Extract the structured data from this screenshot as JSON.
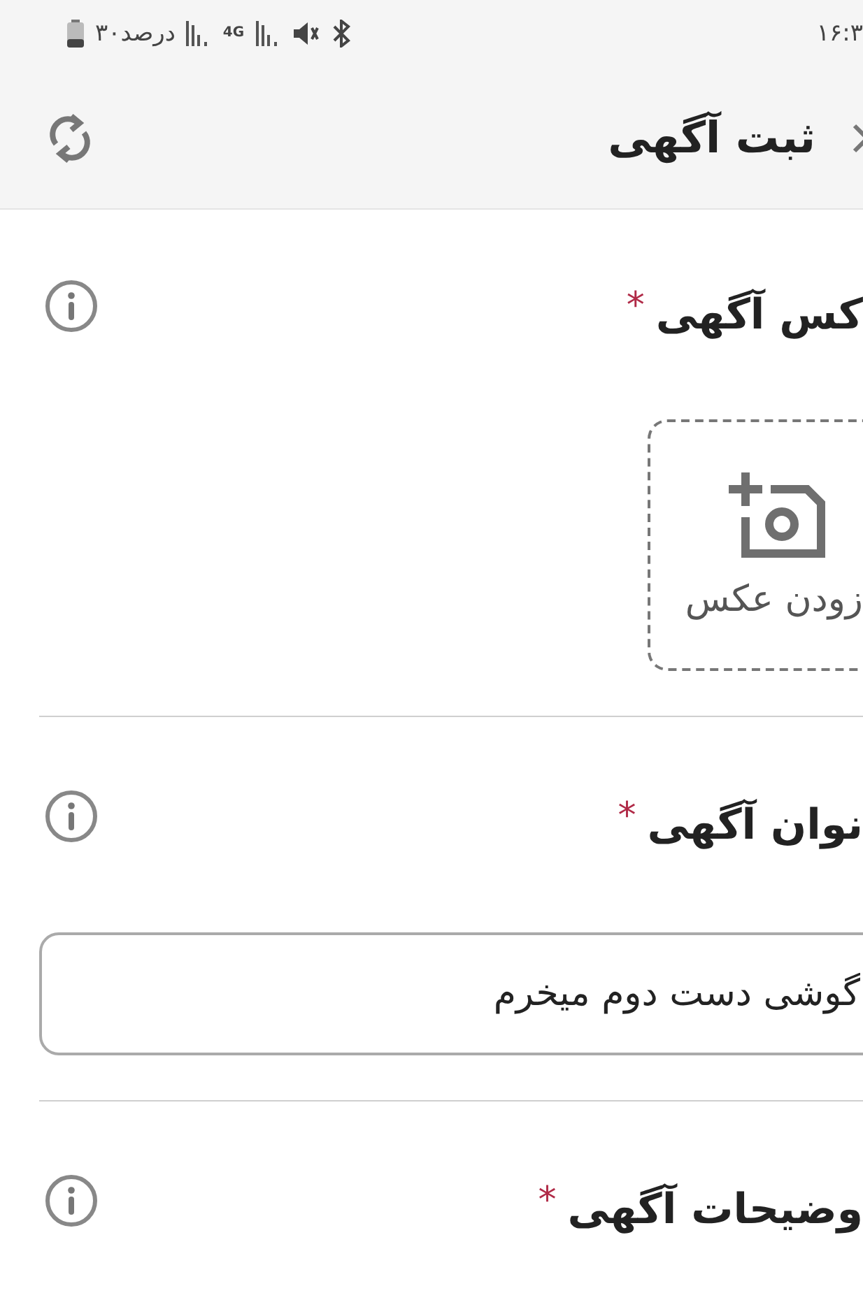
{
  "status_bar": {
    "time": "۱۶:۳",
    "battery": "۳۰درصد",
    "network": "4G"
  },
  "header": {
    "title": "ثبت آگهی"
  },
  "sections": [
    {
      "kind": "photo",
      "title": "کس آگهی",
      "required_mark": "*",
      "add_label": "زودن عکس"
    },
    {
      "kind": "text",
      "title": "نوان آگهی",
      "required_mark": "*",
      "value": "گوشی دست دوم میخرم"
    },
    {
      "kind": "heading",
      "title": "وضیحات آگهی",
      "required_mark": "*"
    }
  ]
}
